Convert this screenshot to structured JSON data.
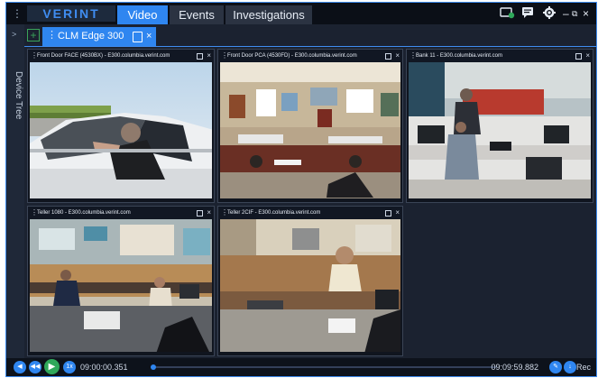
{
  "app": {
    "logo": "VERINT",
    "tabs": [
      {
        "label": "Video"
      },
      {
        "label": "Events"
      },
      {
        "label": "Investigations"
      }
    ],
    "window_controls": {
      "minimize": "–",
      "restore": "⧉",
      "close": "×"
    }
  },
  "sidebar": {
    "label": "Device Tree"
  },
  "view_tab": {
    "title": "CLM Edge 300",
    "close": "×",
    "add": "+"
  },
  "panes": [
    {
      "title": "Front Door FACE (4530BX) - E300.columbia.verint.com"
    },
    {
      "title": "Front Door PCA (4530FD) - E300.columbia.verint.com"
    },
    {
      "title": "Bank 11 - E300.columbia.verint.com"
    },
    {
      "title": "Teller 1080 - E300.columbia.verint.com"
    },
    {
      "title": "Teller 2CIF - E300.columbia.verint.com"
    }
  ],
  "playback": {
    "start_time": "09:00:00.351",
    "end_time": "09:09:59.882",
    "rec_label": "Rec",
    "position_fraction": 0.0
  },
  "colors": {
    "accent": "#2f86f0",
    "play": "#2fa85a",
    "background": "#1b2230",
    "topbar": "#0b0f17"
  }
}
